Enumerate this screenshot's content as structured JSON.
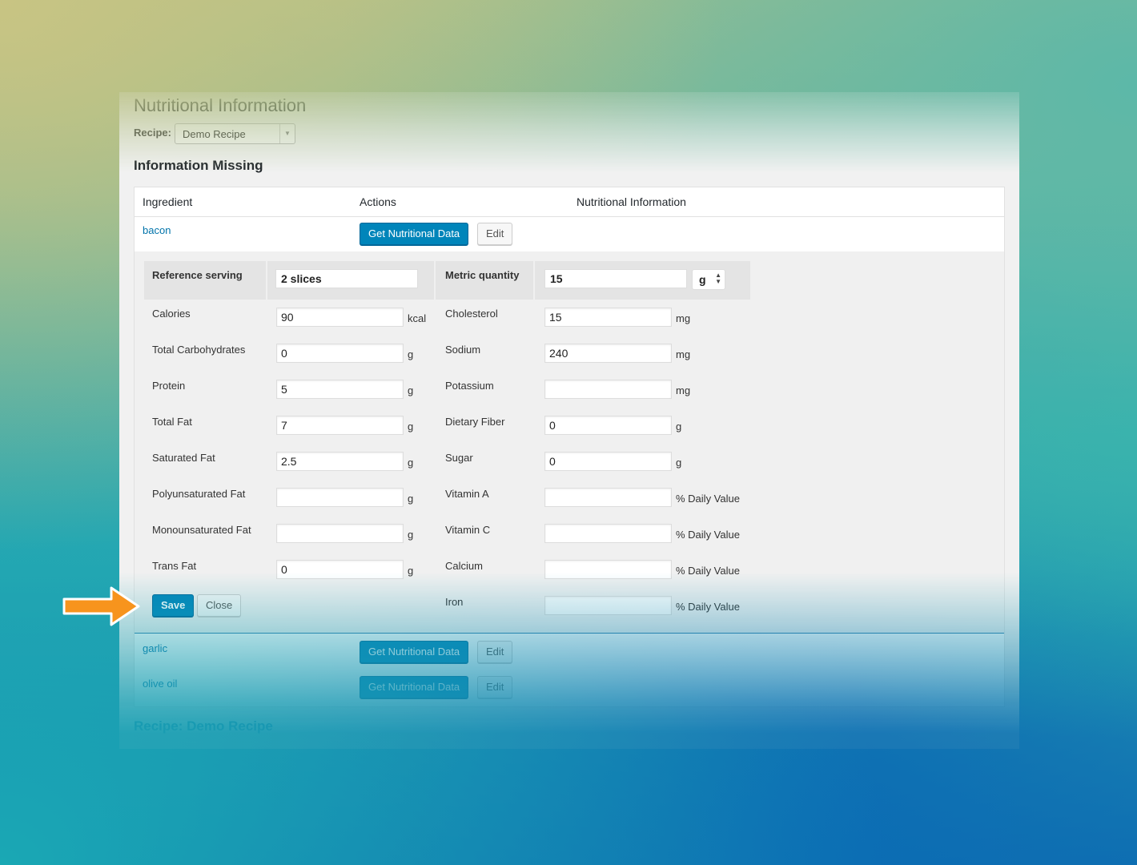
{
  "page": {
    "title": "Nutritional Information",
    "recipe_label": "Recipe:",
    "recipe_selected": "Demo Recipe",
    "section_title": "Information Missing",
    "footer_recipe": "Recipe: Demo Recipe"
  },
  "table": {
    "headers": [
      "Ingredient",
      "Actions",
      "Nutritional Information"
    ],
    "rows": [
      {
        "name": "bacon",
        "get_label": "Get Nutritional Data",
        "edit_label": "Edit"
      },
      {
        "name": "garlic",
        "get_label": "Get Nutritional Data",
        "edit_label": "Edit"
      },
      {
        "name": "olive oil",
        "get_label": "Get Nutritional Data",
        "edit_label": "Edit"
      }
    ]
  },
  "editor": {
    "reference_serving_label": "Reference serving",
    "reference_serving_value": "2 slices",
    "metric_quantity_label": "Metric quantity",
    "metric_quantity_value": "15",
    "metric_unit": "g",
    "left_fields": [
      {
        "label": "Calories",
        "value": "90",
        "unit": "kcal"
      },
      {
        "label": "Total Carbohydrates",
        "value": "0",
        "unit": "g"
      },
      {
        "label": "Protein",
        "value": "5",
        "unit": "g"
      },
      {
        "label": "Total Fat",
        "value": "7",
        "unit": "g"
      },
      {
        "label": "Saturated Fat",
        "value": "2.5",
        "unit": "g"
      },
      {
        "label": "Polyunsaturated Fat",
        "value": "",
        "unit": "g"
      },
      {
        "label": "Monounsaturated Fat",
        "value": "",
        "unit": "g"
      },
      {
        "label": "Trans Fat",
        "value": "0",
        "unit": "g"
      }
    ],
    "right_fields": [
      {
        "label": "Cholesterol",
        "value": "15",
        "unit": "mg"
      },
      {
        "label": "Sodium",
        "value": "240",
        "unit": "mg"
      },
      {
        "label": "Potassium",
        "value": "",
        "unit": "mg"
      },
      {
        "label": "Dietary Fiber",
        "value": "0",
        "unit": "g"
      },
      {
        "label": "Sugar",
        "value": "0",
        "unit": "g"
      },
      {
        "label": "Vitamin A",
        "value": "",
        "unit": "% Daily Value"
      },
      {
        "label": "Vitamin C",
        "value": "",
        "unit": "% Daily Value"
      },
      {
        "label": "Calcium",
        "value": "",
        "unit": "% Daily Value"
      },
      {
        "label": "Iron",
        "value": "",
        "unit": "% Daily Value"
      }
    ],
    "save_label": "Save",
    "close_label": "Close"
  },
  "colors": {
    "primary_button": "#0085ba",
    "link": "#0073aa",
    "pointer_arrow": "#f7941d"
  }
}
